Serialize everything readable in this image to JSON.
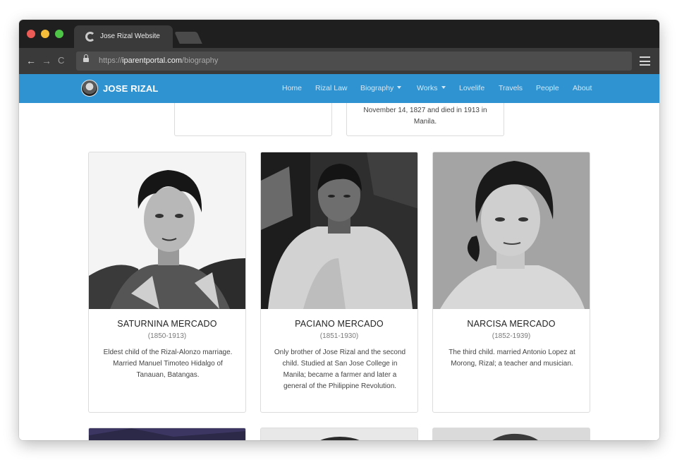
{
  "browser": {
    "tab_title": "Jose Rizal Website",
    "url_scheme": "https://",
    "url_domain": "iparentportal.com",
    "url_path": "/biography",
    "back_glyph": "←",
    "forward_glyph": "→",
    "reload_glyph": "C",
    "icons": [
      "chrome-icon",
      "back-icon",
      "forward-icon",
      "reload-icon",
      "lock-icon",
      "menu-icon"
    ]
  },
  "site": {
    "brand": "JOSE RIZAL",
    "nav": [
      "Home",
      "Rizal Law",
      "Biography",
      "Works",
      "Lovelife",
      "Travels",
      "People",
      "About"
    ],
    "accent": "#2f93d1"
  },
  "top_cards": [
    {
      "text": ""
    },
    {
      "text": "November 14, 1827 and died in 1913 in Manila."
    }
  ],
  "people": [
    {
      "name": "SATURNINA MERCADO",
      "years": "(1850-1913)",
      "description": "Eldest child of the Rizal-Alonzo marriage. Married Manuel Timoteo Hidalgo of Tanauan, Batangas."
    },
    {
      "name": "PACIANO MERCADO",
      "years": "(1851-1930)",
      "description": "Only brother of Jose Rizal and the second child. Studied at San Jose College in Manila; became a farmer and later a general of the Philippine Revolution."
    },
    {
      "name": "NARCISA MERCADO",
      "years": "(1852-1939)",
      "description": "The third child. married Antonio Lopez at Morong, Rizal; a teacher and musician."
    }
  ]
}
